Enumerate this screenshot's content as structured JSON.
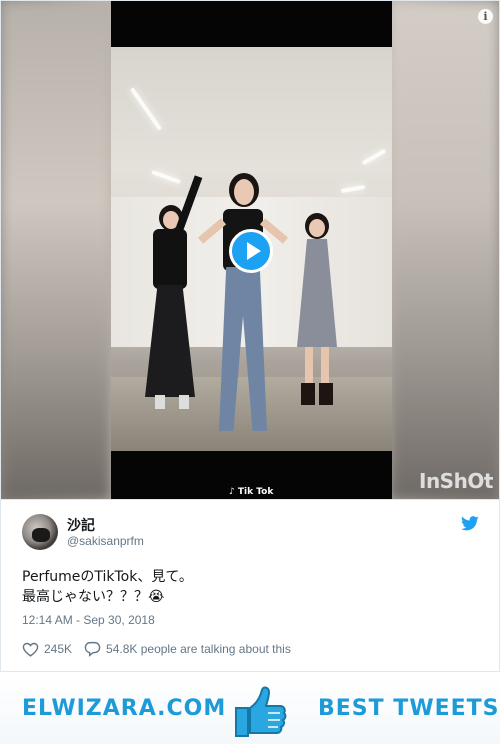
{
  "media": {
    "tiktok_watermark": "Tik Tok",
    "inshot_watermark": "InShOt",
    "info_icon": "i"
  },
  "tweet": {
    "display_name": "沙記",
    "handle": "@sakisanprfm",
    "text_line_1": "PerfumeのTikTok、見て。",
    "text_line_2": "最高じゃない？？？😭",
    "timestamp": "12:14 AM - Sep 30, 2018",
    "likes": "245K",
    "talking": "54.8K people are talking about this"
  },
  "footer": {
    "left_text": "ELWIZARA.COM",
    "right_text": "BEST TWEETS"
  },
  "colors": {
    "accent": "#1da1f2",
    "footer_text": "#1d9bd8",
    "secondary_text": "#657786"
  },
  "icons": {
    "play": "play-icon",
    "info": "info-icon",
    "twitter": "twitter-bird-icon",
    "heart": "heart-icon",
    "comment": "comment-icon",
    "thumbs_up": "thumbs-up-icon"
  }
}
